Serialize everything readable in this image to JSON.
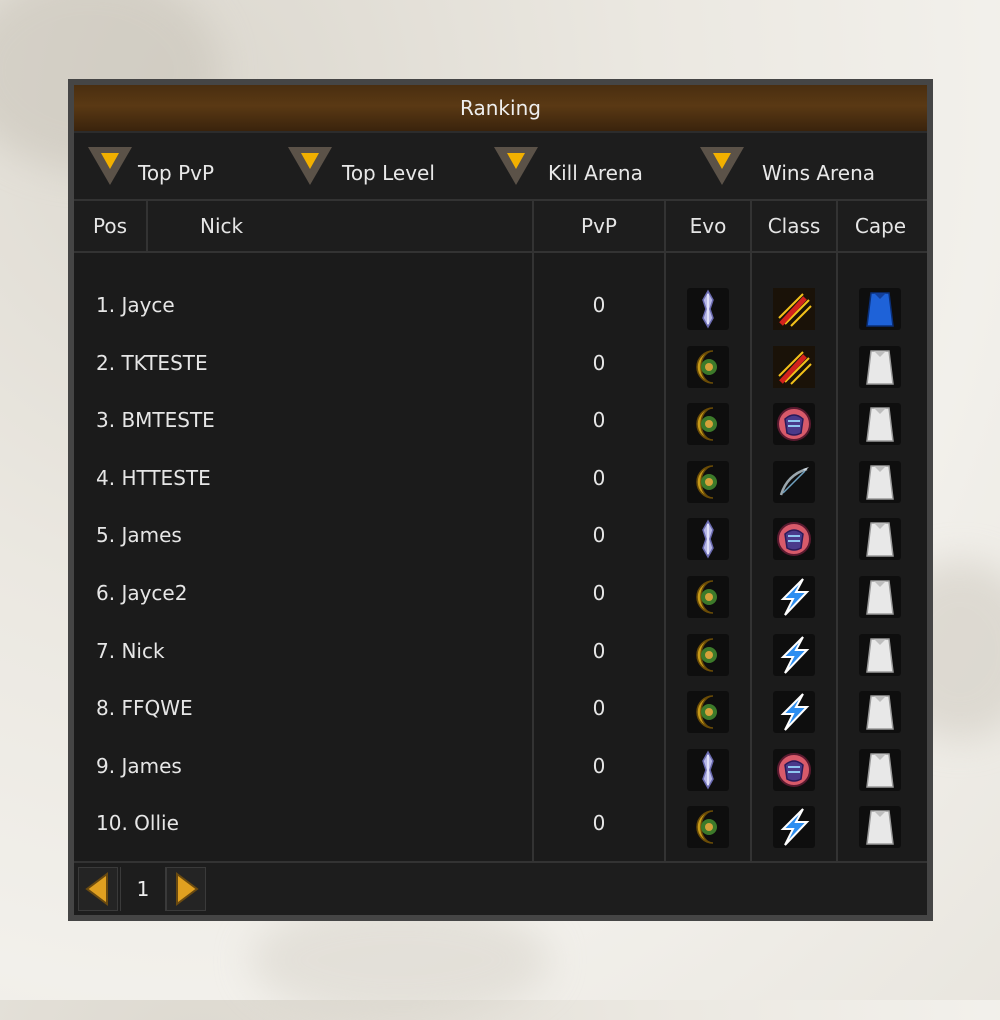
{
  "window": {
    "title": "Ranking"
  },
  "tabs": [
    {
      "label": "Top PvP"
    },
    {
      "label": "Top Level"
    },
    {
      "label": "Kill Arena"
    },
    {
      "label": "Wins Arena"
    }
  ],
  "columns": {
    "pos": "Pos",
    "nick": "Nick",
    "pvp": "PvP",
    "evo": "Evo",
    "class": "Class",
    "cape": "Cape"
  },
  "rows": [
    {
      "nick": "1. Jayce",
      "pvp": "0",
      "evo": "crystal-icon",
      "class": "blade-icon",
      "cape": "blue-cape-icon"
    },
    {
      "nick": "2. TKTESTE",
      "pvp": "0",
      "evo": "shield-icon",
      "class": "blade-icon",
      "cape": "white-cape-icon"
    },
    {
      "nick": "3. BMTESTE",
      "pvp": "0",
      "evo": "shield-icon",
      "class": "fist-icon",
      "cape": "white-cape-icon"
    },
    {
      "nick": "4. HTTESTE",
      "pvp": "0",
      "evo": "shield-icon",
      "class": "bow-icon",
      "cape": "white-cape-icon"
    },
    {
      "nick": "5. James",
      "pvp": "0",
      "evo": "crystal-icon",
      "class": "fist-icon",
      "cape": "white-cape-icon"
    },
    {
      "nick": "6. Jayce2",
      "pvp": "0",
      "evo": "shield-icon",
      "class": "lightning-icon",
      "cape": "white-cape-icon"
    },
    {
      "nick": "7. Nick",
      "pvp": "0",
      "evo": "shield-icon",
      "class": "lightning-icon",
      "cape": "white-cape-icon"
    },
    {
      "nick": "8. FFQWE",
      "pvp": "0",
      "evo": "shield-icon",
      "class": "lightning-icon",
      "cape": "white-cape-icon"
    },
    {
      "nick": "9. James",
      "pvp": "0",
      "evo": "crystal-icon",
      "class": "fist-icon",
      "cape": "white-cape-icon"
    },
    {
      "nick": "10. Ollie",
      "pvp": "0",
      "evo": "shield-icon",
      "class": "lightning-icon",
      "cape": "white-cape-icon"
    }
  ],
  "pagination": {
    "page": "1"
  },
  "colors": {
    "accent": "#f2b000",
    "title_bar": "#5a3914",
    "panel": "#1b1b1b",
    "text": "#e6e6e6"
  }
}
